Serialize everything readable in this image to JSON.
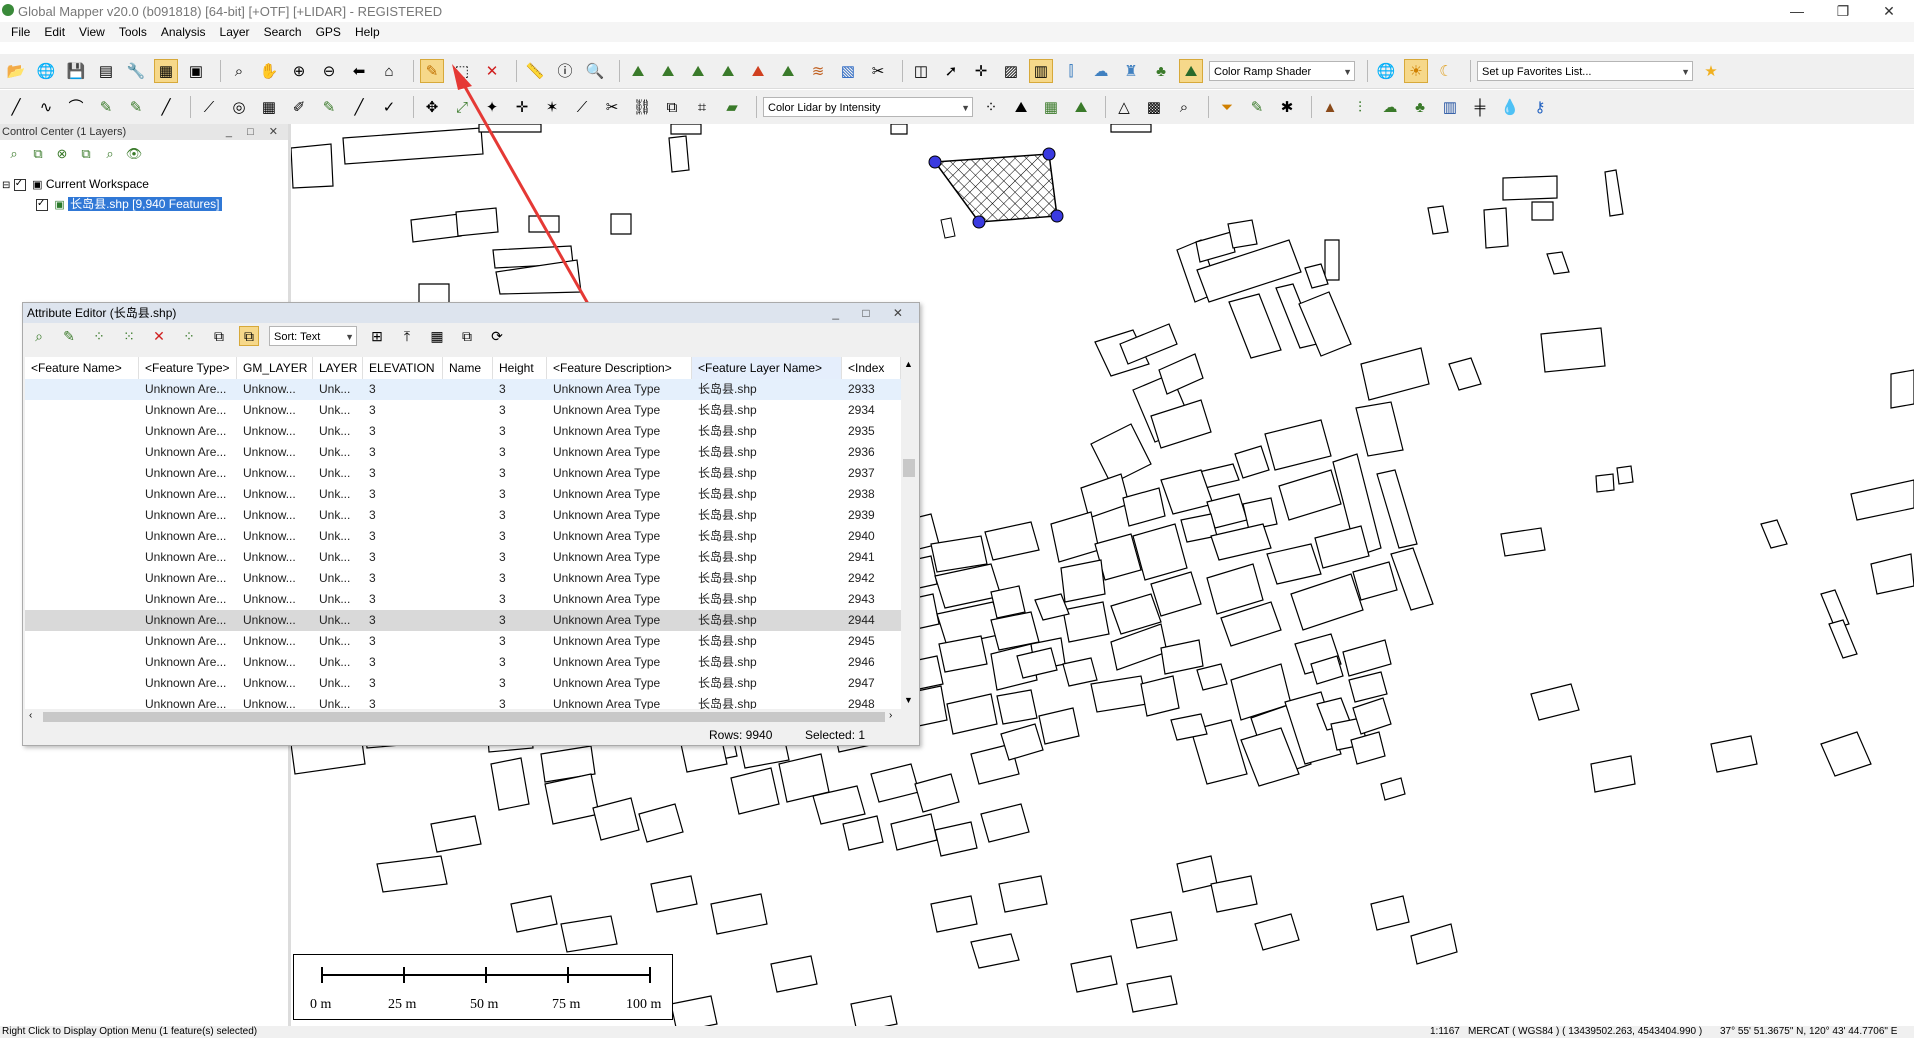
{
  "window": {
    "title": "Global Mapper v20.0 (b091818) [64-bit] [+OTF] [+LIDAR] - REGISTERED",
    "controls": [
      "—",
      "❐",
      "✕"
    ]
  },
  "menubar": [
    "File",
    "Edit",
    "View",
    "Tools",
    "Analysis",
    "Layer",
    "Search",
    "GPS",
    "Help"
  ],
  "toolbar1": {
    "shader_select": "Color Ramp Shader",
    "favorites_select": "Set up Favorites List..."
  },
  "toolbar2": {
    "lidar_select": "Color Lidar by Intensity"
  },
  "control_center": {
    "title": "Control Center (1 Layers)",
    "workspace": "Current Workspace",
    "layer": "长岛县.shp [9,940 Features]"
  },
  "attribute_editor": {
    "title": "Attribute Editor (长岛县.shp)",
    "sort_label": "Sort: Text",
    "columns": [
      "<Feature Name>",
      "<Feature Type>",
      "GM_LAYER",
      "LAYER",
      "ELEVATION",
      "Name",
      "Height",
      "<Feature Description>",
      "<Feature Layer Name>",
      "<Index"
    ],
    "rows": [
      {
        "name": "",
        "type": "Unknown Are...",
        "gm_layer": "Unknow...",
        "layer": "Unk...",
        "elevation": "3",
        "fname": "",
        "height": "3",
        "desc": "Unknown Area Type",
        "layer_name": "长岛县.shp",
        "index": "2933"
      },
      {
        "name": "",
        "type": "Unknown Are...",
        "gm_layer": "Unknow...",
        "layer": "Unk...",
        "elevation": "3",
        "fname": "",
        "height": "3",
        "desc": "Unknown Area Type",
        "layer_name": "长岛县.shp",
        "index": "2934"
      },
      {
        "name": "",
        "type": "Unknown Are...",
        "gm_layer": "Unknow...",
        "layer": "Unk...",
        "elevation": "3",
        "fname": "",
        "height": "3",
        "desc": "Unknown Area Type",
        "layer_name": "长岛县.shp",
        "index": "2935"
      },
      {
        "name": "",
        "type": "Unknown Are...",
        "gm_layer": "Unknow...",
        "layer": "Unk...",
        "elevation": "3",
        "fname": "",
        "height": "3",
        "desc": "Unknown Area Type",
        "layer_name": "长岛县.shp",
        "index": "2936"
      },
      {
        "name": "",
        "type": "Unknown Are...",
        "gm_layer": "Unknow...",
        "layer": "Unk...",
        "elevation": "3",
        "fname": "",
        "height": "3",
        "desc": "Unknown Area Type",
        "layer_name": "长岛县.shp",
        "index": "2937"
      },
      {
        "name": "",
        "type": "Unknown Are...",
        "gm_layer": "Unknow...",
        "layer": "Unk...",
        "elevation": "3",
        "fname": "",
        "height": "3",
        "desc": "Unknown Area Type",
        "layer_name": "长岛县.shp",
        "index": "2938"
      },
      {
        "name": "",
        "type": "Unknown Are...",
        "gm_layer": "Unknow...",
        "layer": "Unk...",
        "elevation": "3",
        "fname": "",
        "height": "3",
        "desc": "Unknown Area Type",
        "layer_name": "长岛县.shp",
        "index": "2939"
      },
      {
        "name": "",
        "type": "Unknown Are...",
        "gm_layer": "Unknow...",
        "layer": "Unk...",
        "elevation": "3",
        "fname": "",
        "height": "3",
        "desc": "Unknown Area Type",
        "layer_name": "长岛县.shp",
        "index": "2940"
      },
      {
        "name": "",
        "type": "Unknown Are...",
        "gm_layer": "Unknow...",
        "layer": "Unk...",
        "elevation": "3",
        "fname": "",
        "height": "3",
        "desc": "Unknown Area Type",
        "layer_name": "长岛县.shp",
        "index": "2941"
      },
      {
        "name": "",
        "type": "Unknown Are...",
        "gm_layer": "Unknow...",
        "layer": "Unk...",
        "elevation": "3",
        "fname": "",
        "height": "3",
        "desc": "Unknown Area Type",
        "layer_name": "长岛县.shp",
        "index": "2942"
      },
      {
        "name": "",
        "type": "Unknown Are...",
        "gm_layer": "Unknow...",
        "layer": "Unk...",
        "elevation": "3",
        "fname": "",
        "height": "3",
        "desc": "Unknown Area Type",
        "layer_name": "长岛县.shp",
        "index": "2943"
      },
      {
        "name": "",
        "type": "Unknown Are...",
        "gm_layer": "Unknow...",
        "layer": "Unk...",
        "elevation": "3",
        "fname": "",
        "height": "3",
        "desc": "Unknown Area Type",
        "layer_name": "长岛县.shp",
        "index": "2944"
      },
      {
        "name": "",
        "type": "Unknown Are...",
        "gm_layer": "Unknow...",
        "layer": "Unk...",
        "elevation": "3",
        "fname": "",
        "height": "3",
        "desc": "Unknown Area Type",
        "layer_name": "长岛县.shp",
        "index": "2945"
      },
      {
        "name": "",
        "type": "Unknown Are...",
        "gm_layer": "Unknow...",
        "layer": "Unk...",
        "elevation": "3",
        "fname": "",
        "height": "3",
        "desc": "Unknown Area Type",
        "layer_name": "长岛县.shp",
        "index": "2946"
      },
      {
        "name": "",
        "type": "Unknown Are...",
        "gm_layer": "Unknow...",
        "layer": "Unk...",
        "elevation": "3",
        "fname": "",
        "height": "3",
        "desc": "Unknown Area Type",
        "layer_name": "长岛县.shp",
        "index": "2947"
      },
      {
        "name": "",
        "type": "Unknown Are...",
        "gm_layer": "Unknow...",
        "layer": "Unk...",
        "elevation": "3",
        "fname": "",
        "height": "3",
        "desc": "Unknown Area Type",
        "layer_name": "长岛县.shp",
        "index": "2948"
      }
    ],
    "selected_index": 11,
    "rows_label": "Rows: 9940",
    "selected_label": "Selected: 1"
  },
  "scale_bar": {
    "labels": [
      "0 m",
      "25 m",
      "50 m",
      "75 m",
      "100 m"
    ]
  },
  "status_bar": {
    "left": "Right Click to Display Option Menu (1 feature(s) selected)",
    "scale": "1:1167",
    "projection": "MERCAT ( WGS84 ) ( 13439502.263, 4543404.990 )",
    "coords": "37° 55' 51.3675\" N, 120° 43' 44.7706\" E"
  },
  "colors": {
    "selection_highlight": "#3078d6",
    "annotation_arrow": "#e53935",
    "selected_vertex": "#3a3ae0"
  },
  "icons": {
    "toolbar1": [
      "open-folder-icon",
      "globe-icon",
      "save-icon",
      "print-icon",
      "wrench-icon",
      "layers-icon",
      "overview-icon",
      "zoom-area-icon",
      "pan-hand-icon",
      "zoom-in-icon",
      "zoom-out-icon",
      "back-icon",
      "home-icon",
      "edit-pencil-icon",
      "select-box-icon",
      "delete-x-icon",
      "measure-icon",
      "info-icon",
      "search-window-icon",
      "terrain-icon",
      "terrain-2-icon",
      "terrain-3-icon",
      "terrain-4-icon",
      "terrain-5-icon",
      "terrain-6-icon",
      "contour-icon",
      "image-icon",
      "tools-icon",
      "split-view-icon",
      "path-profile-icon",
      "crosshair-icon",
      "3d-view-icon",
      "lidar-icon",
      "measure-height-icon",
      "cloud-icon",
      "tower-icon",
      "mountains-icon"
    ],
    "toolbar2": [
      "digitize-line-icon",
      "digitize-curve-icon",
      "digitize-area-icon",
      "digitize-point-icon",
      "edit-vertex-icon",
      "move-icon",
      "rotate-icon",
      "reshape-icon",
      "split-icon",
      "merge-icon",
      "path-icon",
      "target-icon",
      "grid-icon",
      "snap-icon",
      "join-icon",
      "classify-icon",
      "filter-icon",
      "ground-icon",
      "building-icon",
      "tree-icon",
      "tower-lines-icon",
      "powerline-icon",
      "water-icon",
      "key-icon"
    ]
  }
}
